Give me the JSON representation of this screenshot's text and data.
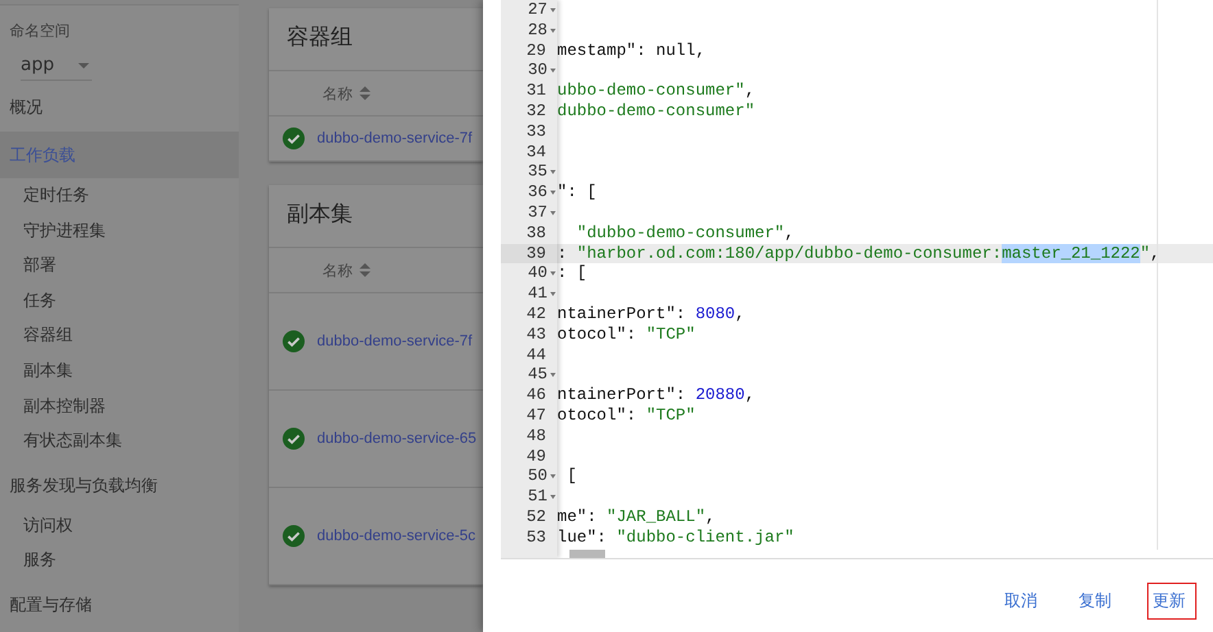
{
  "sidebar": {
    "namespace_label": "命名空间",
    "namespace": "app",
    "items": [
      {
        "label": "概况",
        "selected": false
      },
      {
        "label": "工作负载",
        "selected": true,
        "children": [
          {
            "label": "定时任务",
            "selected": false
          },
          {
            "label": "守护进程集",
            "selected": false
          },
          {
            "label": "部署",
            "selected": false
          },
          {
            "label": "任务",
            "selected": false
          },
          {
            "label": "容器组",
            "selected": false
          },
          {
            "label": "副本集",
            "selected": false
          },
          {
            "label": "副本控制器",
            "selected": false
          },
          {
            "label": "有状态副本集",
            "selected": false
          }
        ]
      },
      {
        "label": "服务发现与负载均衡",
        "selected": false,
        "children": [
          {
            "label": "访问权",
            "selected": false
          },
          {
            "label": "服务",
            "selected": false
          }
        ]
      },
      {
        "label": "配置与存储",
        "selected": false
      }
    ]
  },
  "cards": [
    {
      "title": "容器组",
      "column": "名称",
      "rows": [
        {
          "name": "dubbo-demo-service-7f"
        }
      ]
    },
    {
      "title": "副本集",
      "column": "名称",
      "rows": [
        {
          "name": "dubbo-demo-service-7f"
        },
        {
          "name": "dubbo-demo-service-65"
        },
        {
          "name": "dubbo-demo-service-5c"
        }
      ]
    }
  ],
  "editor": {
    "lines": [
      {
        "number": "27",
        "foldable": true,
        "current": false
      },
      {
        "number": "28",
        "foldable": true,
        "current": false
      },
      {
        "number": "29",
        "foldable": false,
        "current": false,
        "tokens": [
          {
            "kind": "key",
            "text": "mestamp\": "
          },
          {
            "kind": "plain",
            "text": "null,"
          }
        ]
      },
      {
        "number": "30",
        "foldable": true,
        "current": false
      },
      {
        "number": "31",
        "foldable": false,
        "current": false,
        "tokens": [
          {
            "kind": "string",
            "text": "ubbo-demo-consumer\""
          },
          {
            "kind": "plain",
            "text": ","
          }
        ]
      },
      {
        "number": "32",
        "foldable": false,
        "current": false,
        "tokens": [
          {
            "kind": "string",
            "text": "dubbo-demo-consumer\""
          }
        ]
      },
      {
        "number": "33",
        "foldable": false,
        "current": false
      },
      {
        "number": "34",
        "foldable": false,
        "current": false
      },
      {
        "number": "35",
        "foldable": true,
        "current": false
      },
      {
        "number": "36",
        "foldable": true,
        "current": false,
        "tokens": [
          {
            "kind": "key",
            "text": "\": ["
          }
        ]
      },
      {
        "number": "37",
        "foldable": true,
        "current": false
      },
      {
        "number": "38",
        "foldable": false,
        "current": false,
        "tokens": [
          {
            "kind": "string",
            "text": "  \"dubbo-demo-consumer\""
          },
          {
            "kind": "plain",
            "text": ","
          }
        ]
      },
      {
        "number": "39",
        "foldable": false,
        "current": true,
        "tokens": [
          {
            "kind": "plain",
            "text": ": "
          },
          {
            "kind": "string",
            "text": "\"harbor.od.com:180/app/dubbo-demo-consumer:"
          },
          {
            "kind": "selection",
            "text": "master_21_1222"
          },
          {
            "kind": "string",
            "text": "\""
          },
          {
            "kind": "plain",
            "text": ","
          }
        ]
      },
      {
        "number": "40",
        "foldable": true,
        "current": false,
        "tokens": [
          {
            "kind": "plain",
            "text": ": ["
          }
        ]
      },
      {
        "number": "41",
        "foldable": true,
        "current": false
      },
      {
        "number": "42",
        "foldable": false,
        "current": false,
        "tokens": [
          {
            "kind": "key",
            "text": "ntainerPort\": "
          },
          {
            "kind": "number",
            "text": "8080"
          },
          {
            "kind": "plain",
            "text": ","
          }
        ]
      },
      {
        "number": "43",
        "foldable": false,
        "current": false,
        "tokens": [
          {
            "kind": "key",
            "text": "otocol\": "
          },
          {
            "kind": "string",
            "text": "\"TCP\""
          }
        ]
      },
      {
        "number": "44",
        "foldable": false,
        "current": false
      },
      {
        "number": "45",
        "foldable": true,
        "current": false
      },
      {
        "number": "46",
        "foldable": false,
        "current": false,
        "tokens": [
          {
            "kind": "key",
            "text": "ntainerPort\": "
          },
          {
            "kind": "number",
            "text": "20880"
          },
          {
            "kind": "plain",
            "text": ","
          }
        ]
      },
      {
        "number": "47",
        "foldable": false,
        "current": false,
        "tokens": [
          {
            "kind": "key",
            "text": "otocol\": "
          },
          {
            "kind": "string",
            "text": "\"TCP\""
          }
        ]
      },
      {
        "number": "48",
        "foldable": false,
        "current": false
      },
      {
        "number": "49",
        "foldable": false,
        "current": false
      },
      {
        "number": "50",
        "foldable": true,
        "current": false,
        "tokens": [
          {
            "kind": "plain",
            "text": " ["
          }
        ]
      },
      {
        "number": "51",
        "foldable": true,
        "current": false
      },
      {
        "number": "52",
        "foldable": false,
        "current": false,
        "tokens": [
          {
            "kind": "key",
            "text": "me\": "
          },
          {
            "kind": "string",
            "text": "\"JAR_BALL\""
          },
          {
            "kind": "plain",
            "text": ","
          }
        ]
      },
      {
        "number": "53",
        "foldable": false,
        "current": false,
        "tokens": [
          {
            "kind": "key",
            "text": "lue\": "
          },
          {
            "kind": "string",
            "text": "\"dubbo-client.jar\""
          }
        ]
      }
    ]
  },
  "buttons": [
    {
      "label": "取消",
      "highlighted": false
    },
    {
      "label": "复制",
      "highlighted": false
    },
    {
      "label": "更新",
      "highlighted": true
    }
  ]
}
